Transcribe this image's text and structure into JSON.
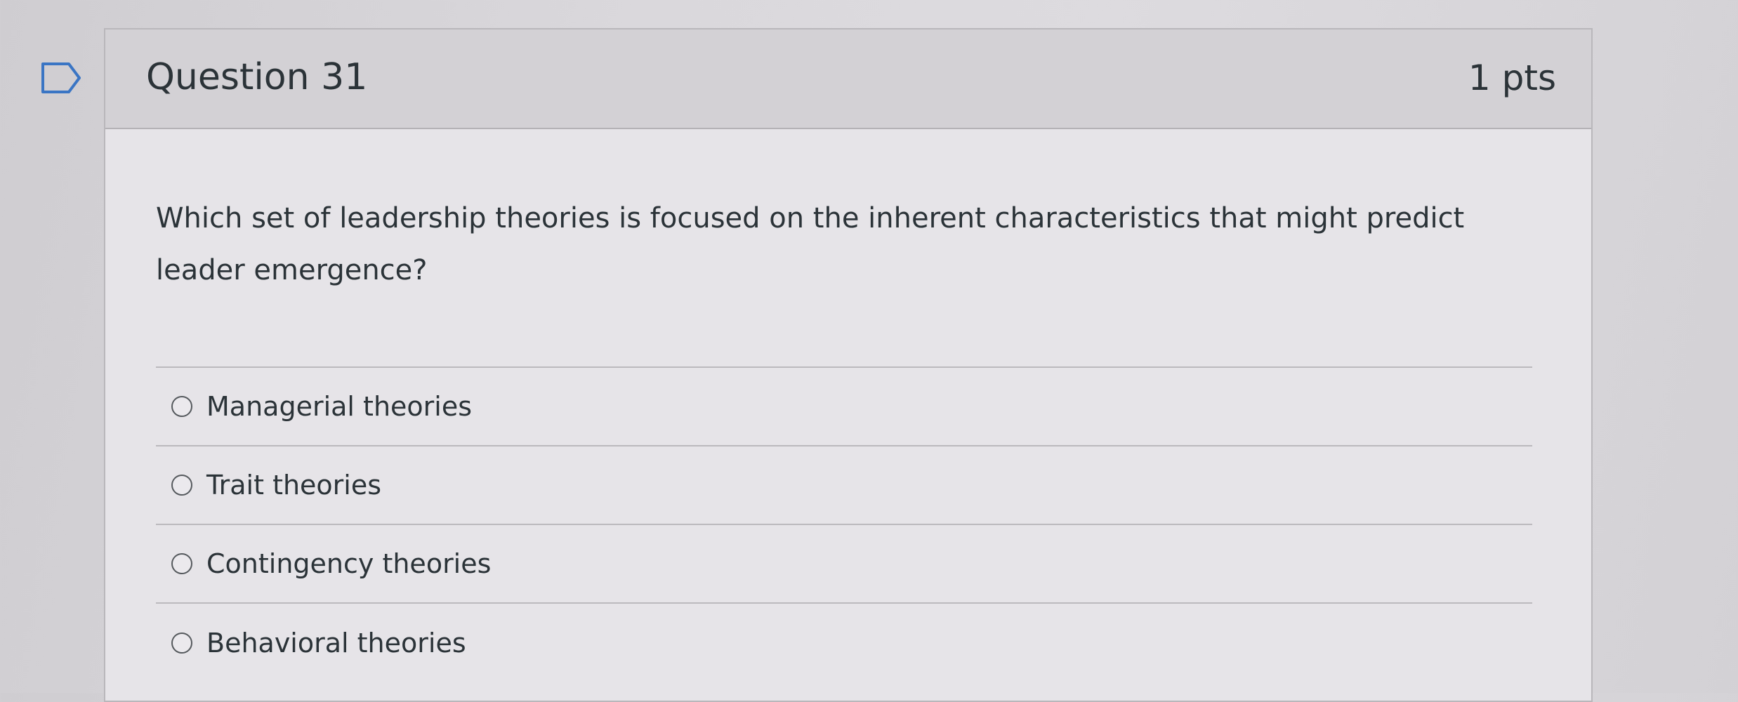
{
  "question": {
    "title": "Question 31",
    "points": "1 pts",
    "text": "Which set of leadership theories is focused on the inherent characteristics that might predict leader emergence?",
    "answers": [
      {
        "label": "Managerial theories",
        "selected": false
      },
      {
        "label": "Trait theories",
        "selected": false
      },
      {
        "label": "Contingency theories",
        "selected": false
      },
      {
        "label": "Behavioral theories",
        "selected": false
      }
    ]
  },
  "icons": {
    "bookmark": "bookmark-flag-icon",
    "radio": "radio-button-icon"
  },
  "colors": {
    "header_bg": "#d3d1d5",
    "card_bg": "#e6e4e8",
    "text": "#2b3338",
    "divider": "#bbb9bd"
  }
}
